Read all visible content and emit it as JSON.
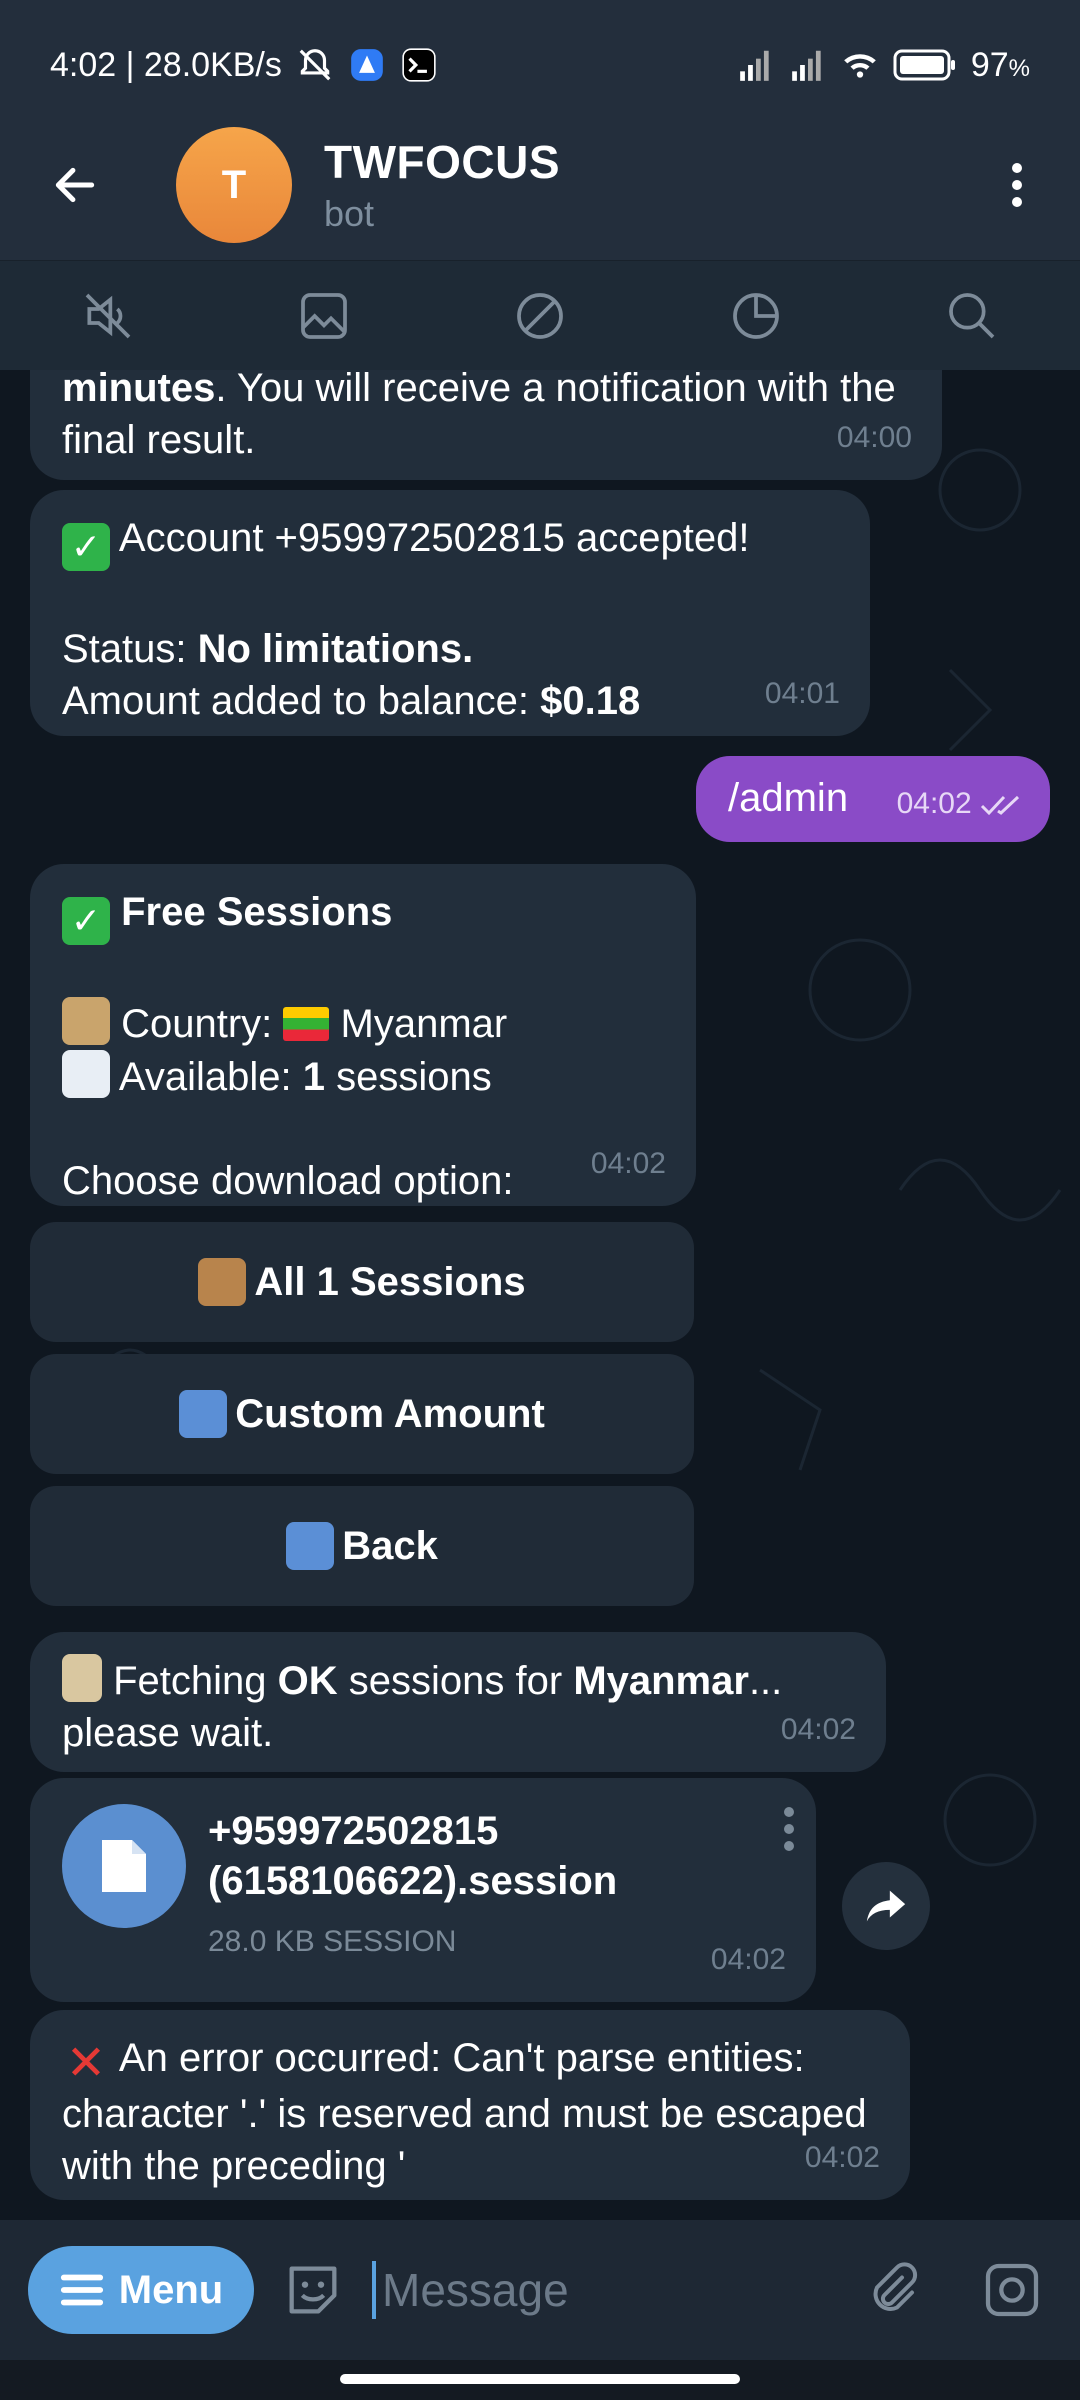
{
  "status_bar": {
    "time_speed": "4:02 | 28.0KB/s",
    "battery": "97",
    "battery_unit": "%"
  },
  "header": {
    "avatar_letter": "T",
    "title": "TWFOCUS",
    "subtitle": "bot"
  },
  "messages": {
    "m1": {
      "bold": "minutes",
      "text": ". You will receive a notification with the final result.",
      "time": "04:00"
    },
    "m2": {
      "line1": "Account +959972502815 accepted!",
      "status_label": "Status: ",
      "status_value": "No limitations.",
      "amount_label": "Amount added to balance: ",
      "amount_value": "$0.18",
      "time": "04:01"
    },
    "m3": {
      "text": "/admin",
      "time": "04:02"
    },
    "m4": {
      "title": "Free Sessions",
      "country_label": "Country: ",
      "country_value": "Myanmar",
      "available_label": "Available: ",
      "available_value": "1",
      "available_suffix": " sessions",
      "choose": "Choose download option:",
      "time": "04:02"
    },
    "buttons": [
      "All 1 Sessions",
      "Custom Amount",
      "Back"
    ],
    "m5": {
      "text1": "Fetching ",
      "bold1": "OK",
      "text2": " sessions for ",
      "bold2": "Myanmar",
      "text3": "... please wait.",
      "time": "04:02"
    },
    "file": {
      "name_line1": "+959972502815",
      "name_line2": "(6158106622).session",
      "meta": "28.0 KB SESSION",
      "time": "04:02"
    },
    "m6": {
      "text": "An error occurred: Can't parse entities: character '.' is reserved and must be escaped with the preceding '",
      "time": "04:02"
    }
  },
  "input": {
    "menu_label": "Menu",
    "placeholder": "Message"
  },
  "colors": {
    "outgoing": "#8a4bc7",
    "incoming": "#222e3b",
    "accent": "#5aa2e0",
    "avatar": "#f0983f"
  }
}
